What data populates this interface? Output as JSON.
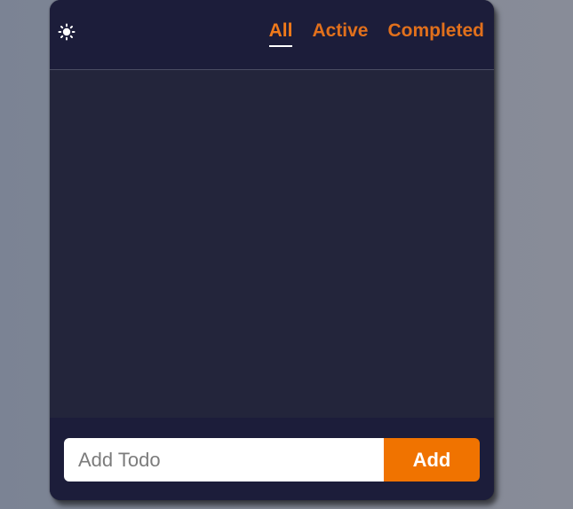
{
  "header": {
    "theme_icon": "sun-icon",
    "filters": [
      {
        "label": "All",
        "active": true
      },
      {
        "label": "Active",
        "active": false
      },
      {
        "label": "Completed",
        "active": false
      }
    ]
  },
  "list": {
    "items": []
  },
  "form": {
    "input_value": "",
    "input_placeholder": "Add Todo",
    "add_label": "Add"
  },
  "colors": {
    "accent": "#f07300",
    "card_bg": "#1c1d3a",
    "list_bg": "#23253b",
    "active_underline": "#ffffff"
  }
}
